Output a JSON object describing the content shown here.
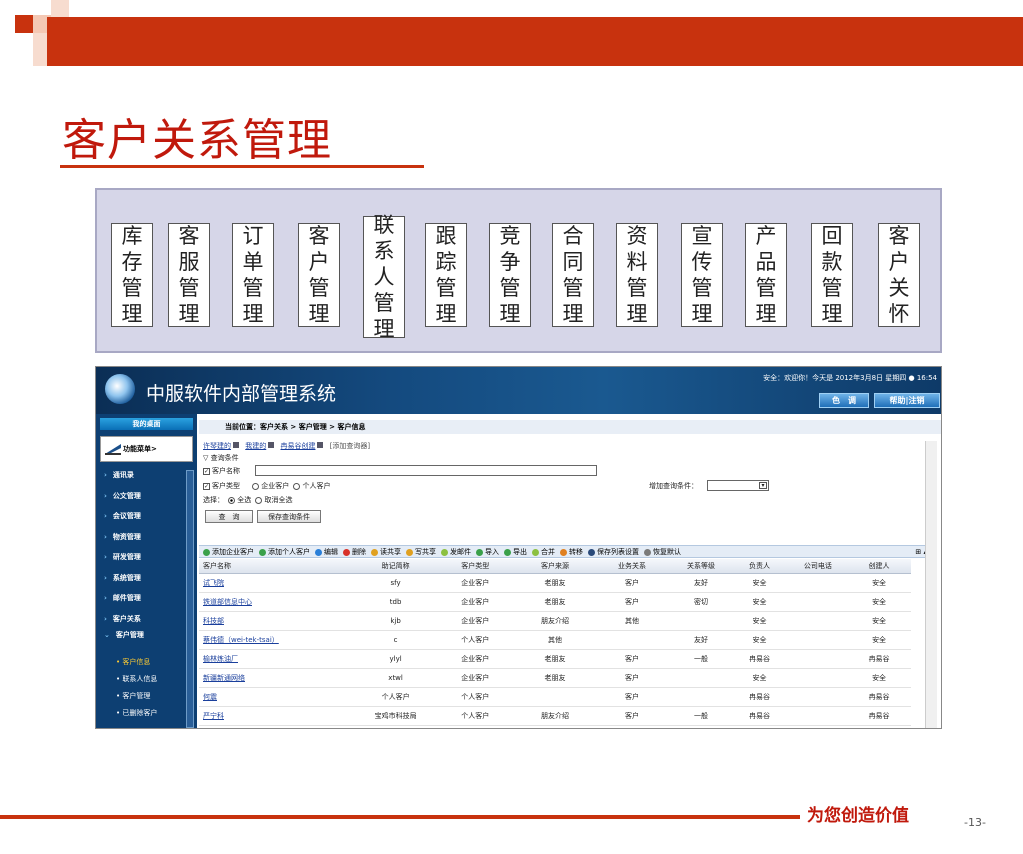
{
  "title": "客户关系管理",
  "modules": [
    "库存管理",
    "客服管理",
    "订单管理",
    "客户管理",
    "联系人管理",
    "跟踪管理",
    "竞争管理",
    "合同管理",
    "资料管理",
    "宣传管理",
    "产品管理",
    "回款管理",
    "客户关怀"
  ],
  "app": {
    "title": "中服软件内部管理系统",
    "header_info": "安全：欢迎你！今天是 2012年3月8日 星期四 ● 16:54",
    "color_button": "色　调",
    "help_button": "帮助|注销",
    "sidebar": {
      "home": "我的桌面",
      "menu": "功能菜单>",
      "items": [
        "通讯录",
        "公文管理",
        "会议管理",
        "物资管理",
        "研发管理",
        "系统管理",
        "邮件管理",
        "客户关系",
        "客户管理"
      ],
      "subitems": [
        "客户信息",
        "联系人信息",
        "客户管理",
        "已删除客户"
      ]
    },
    "breadcrumb": "当前位置：客户关系 > 客户管理 > 客户信息",
    "breadcrumb_arrow": "»",
    "query": {
      "links": [
        "许琴建的",
        "我建的",
        "冉易谷创建"
      ],
      "add_query": "[添加查询器]",
      "conditions_label": "▽ 查询条件",
      "name_label": "客户名称",
      "type_label": "客户类型",
      "type_opt1": "企业客户",
      "type_opt2": "个人客户",
      "extra_label": "增加查询条件：",
      "select_label": "选择：",
      "select_all": "全选",
      "deselect_all": "取消全选",
      "query_btn": "查　询",
      "save_btn": "保存查询条件"
    },
    "toolbar": [
      {
        "label": "添加企业客户",
        "color": "#3aa04a"
      },
      {
        "label": "添加个人客户",
        "color": "#3aa04a"
      },
      {
        "label": "编辑",
        "color": "#2a7fd8"
      },
      {
        "label": "删除",
        "color": "#d8322a"
      },
      {
        "label": "读共享",
        "color": "#e0a020"
      },
      {
        "label": "写共享",
        "color": "#e0a020"
      },
      {
        "label": "发邮件",
        "color": "#8cc040"
      },
      {
        "label": "导入",
        "color": "#3aa04a"
      },
      {
        "label": "导出",
        "color": "#3aa04a"
      },
      {
        "label": "合并",
        "color": "#8cc040"
      },
      {
        "label": "转移",
        "color": "#e08020"
      },
      {
        "label": "保存列表设置",
        "color": "#2a4a7a"
      },
      {
        "label": "恢复默认",
        "color": "#7a7a7a"
      }
    ],
    "table": {
      "headers": [
        "客户名称",
        "助记简称",
        "客户类型",
        "客户来源",
        "业务关系",
        "关系等级",
        "负责人",
        "公司电话",
        "创建人"
      ],
      "rows": [
        [
          "试飞院",
          "sfy",
          "企业客户",
          "老朋友",
          "客户",
          "友好",
          "安全",
          "",
          "安全"
        ],
        [
          "铁道部信息中心",
          "tdb",
          "企业客户",
          "老朋友",
          "客户",
          "密切",
          "安全",
          "",
          "安全"
        ],
        [
          "科技部",
          "kjb",
          "企业客户",
          "朋友介绍",
          "其他",
          "",
          "安全",
          "",
          "安全"
        ],
        [
          "蔡伟德（wei-tek-tsai）",
          "c",
          "个人客户",
          "其他",
          "",
          "友好",
          "安全",
          "",
          "安全"
        ],
        [
          "榆林炼油厂",
          "ylyl",
          "企业客户",
          "老朋友",
          "客户",
          "一般",
          "冉易谷",
          "",
          "冉易谷"
        ],
        [
          "新疆新通网络",
          "xtwl",
          "企业客户",
          "老朋友",
          "客户",
          "",
          "安全",
          "",
          "安全"
        ],
        [
          "何震",
          "个人客户",
          "个人客户",
          "",
          "客户",
          "",
          "冉易谷",
          "",
          "冉易谷"
        ],
        [
          "严宁科",
          "宝鸡市科技局",
          "个人客户",
          "朋友介绍",
          "客户",
          "一般",
          "冉易谷",
          "",
          "冉易谷"
        ]
      ]
    }
  },
  "slogan": "为您创造价值",
  "page_number": "-13-"
}
